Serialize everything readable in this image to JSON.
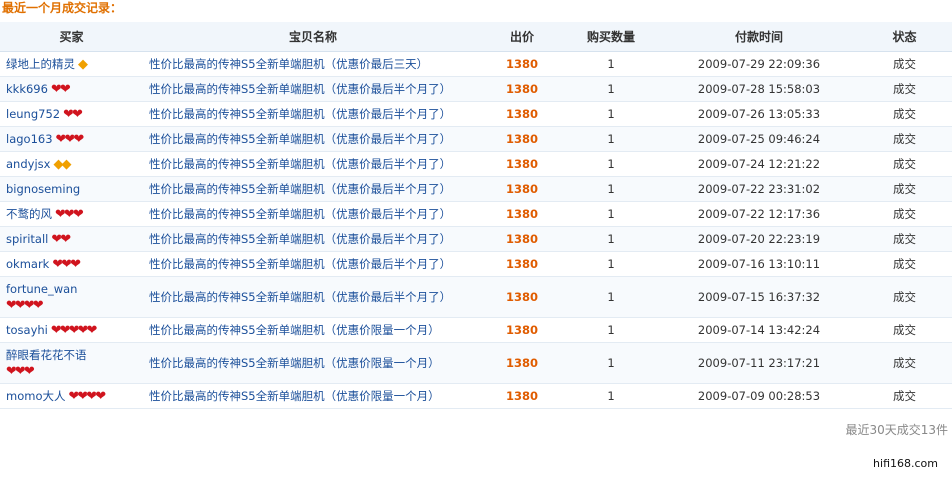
{
  "title": "最近一个月成交记录：",
  "columns": {
    "buyer": "买家",
    "item": "宝贝名称",
    "price": "出价",
    "qty": "购买数量",
    "time": "付款时间",
    "status": "状态"
  },
  "rows": [
    {
      "buyer": "绿地上的精灵",
      "badge": {
        "kind": "diamond",
        "count": 1
      },
      "item": "性价比最高的传神S5全新单端胆机（优惠价最后三天）",
      "price": "1380",
      "qty": "1",
      "time": "2009-07-29 22:09:36",
      "status": "成交"
    },
    {
      "buyer": "kkk696",
      "badge": {
        "kind": "heart",
        "count": 2
      },
      "item": "性价比最高的传神S5全新单端胆机（优惠价最后半个月了）",
      "price": "1380",
      "qty": "1",
      "time": "2009-07-28 15:58:03",
      "status": "成交"
    },
    {
      "buyer": "leung752",
      "badge": {
        "kind": "heart",
        "count": 2
      },
      "item": "性价比最高的传神S5全新单端胆机（优惠价最后半个月了）",
      "price": "1380",
      "qty": "1",
      "time": "2009-07-26 13:05:33",
      "status": "成交"
    },
    {
      "buyer": "lago163",
      "badge": {
        "kind": "heart",
        "count": 3
      },
      "item": "性价比最高的传神S5全新单端胆机（优惠价最后半个月了）",
      "price": "1380",
      "qty": "1",
      "time": "2009-07-25 09:46:24",
      "status": "成交"
    },
    {
      "buyer": "andyjsx",
      "badge": {
        "kind": "diamond",
        "count": 2
      },
      "item": "性价比最高的传神S5全新单端胆机（优惠价最后半个月了）",
      "price": "1380",
      "qty": "1",
      "time": "2009-07-24 12:21:22",
      "status": "成交"
    },
    {
      "buyer": "bignoseming",
      "badge": {
        "kind": "none",
        "count": 0
      },
      "item": "性价比最高的传神S5全新单端胆机（优惠价最后半个月了）",
      "price": "1380",
      "qty": "1",
      "time": "2009-07-22 23:31:02",
      "status": "成交"
    },
    {
      "buyer": "不鹜的风",
      "badge": {
        "kind": "heart",
        "count": 3
      },
      "item": "性价比最高的传神S5全新单端胆机（优惠价最后半个月了）",
      "price": "1380",
      "qty": "1",
      "time": "2009-07-22 12:17:36",
      "status": "成交"
    },
    {
      "buyer": "spiritall",
      "badge": {
        "kind": "heart",
        "count": 2
      },
      "item": "性价比最高的传神S5全新单端胆机（优惠价最后半个月了）",
      "price": "1380",
      "qty": "1",
      "time": "2009-07-20 22:23:19",
      "status": "成交"
    },
    {
      "buyer": "okmark",
      "badge": {
        "kind": "heart",
        "count": 3
      },
      "item": "性价比最高的传神S5全新单端胆机（优惠价最后半个月了）",
      "price": "1380",
      "qty": "1",
      "time": "2009-07-16 13:10:11",
      "status": "成交"
    },
    {
      "buyer": "fortune_wan",
      "badge": {
        "kind": "heart",
        "count": 4
      },
      "wrap": true,
      "item": "性价比最高的传神S5全新单端胆机（优惠价最后半个月了）",
      "price": "1380",
      "qty": "1",
      "time": "2009-07-15 16:37:32",
      "status": "成交"
    },
    {
      "buyer": "tosayhi",
      "badge": {
        "kind": "heart",
        "count": 5
      },
      "item": "性价比最高的传神S5全新单端胆机（优惠价限量一个月）",
      "price": "1380",
      "qty": "1",
      "time": "2009-07-14 13:42:24",
      "status": "成交"
    },
    {
      "buyer": "醉眼看花花不语",
      "badge": {
        "kind": "heart",
        "count": 3
      },
      "wrap": true,
      "item": "性价比最高的传神S5全新单端胆机（优惠价限量一个月）",
      "price": "1380",
      "qty": "1",
      "time": "2009-07-11 23:17:21",
      "status": "成交"
    },
    {
      "buyer": "momo大人",
      "badge": {
        "kind": "heart",
        "count": 4
      },
      "item": "性价比最高的传神S5全新单端胆机（优惠价限量一个月）",
      "price": "1380",
      "qty": "1",
      "time": "2009-07-09 00:28:53",
      "status": "成交"
    }
  ],
  "summary": "最近30天成交13件",
  "watermark": "hifi168.com",
  "colors": {
    "title": "#e07000",
    "link": "#1b4f9a",
    "price": "#e05c00",
    "heart": "#d0141e",
    "diamond": "#f0a000",
    "header_bg": "#f1f6fb"
  }
}
